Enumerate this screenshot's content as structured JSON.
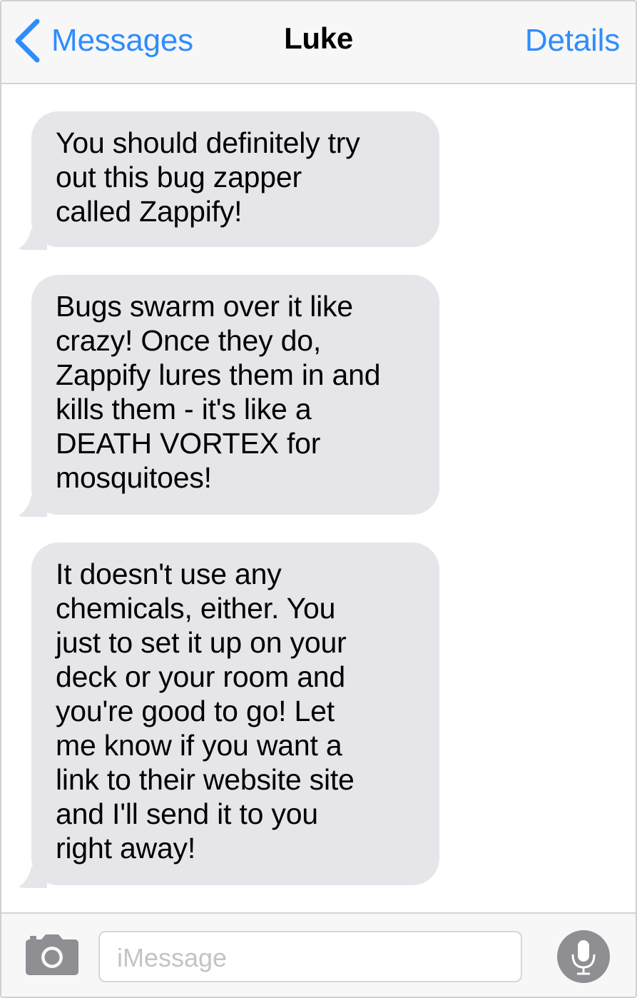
{
  "header": {
    "back_label": "Messages",
    "title": "Luke",
    "details_label": "Details"
  },
  "messages": [
    {
      "text": "You should definitely try\nout this bug zapper\ncalled Zappify!"
    },
    {
      "text": "Bugs swarm over it like\ncrazy! Once they do,\nZappify lures them in and\nkills them - it's like a\nDEATH VORTEX for\nmosquitoes!"
    },
    {
      "text": "It doesn't use any\nchemicals, either. You\njust to set it up on your\ndeck or your room and\nyou're good to go! Let\nme know if you want a\nlink to their website site\nand I'll send it to you\nright away!"
    }
  ],
  "composer": {
    "placeholder": "iMessage"
  },
  "icons": {
    "back": "chevron-left-icon",
    "camera": "camera-icon",
    "mic": "microphone-icon"
  },
  "colors": {
    "accent": "#2f8dfb",
    "bubble_received": "#e5e5ea",
    "bar_background": "#f7f7f8",
    "mic_button": "#8e8e93"
  }
}
